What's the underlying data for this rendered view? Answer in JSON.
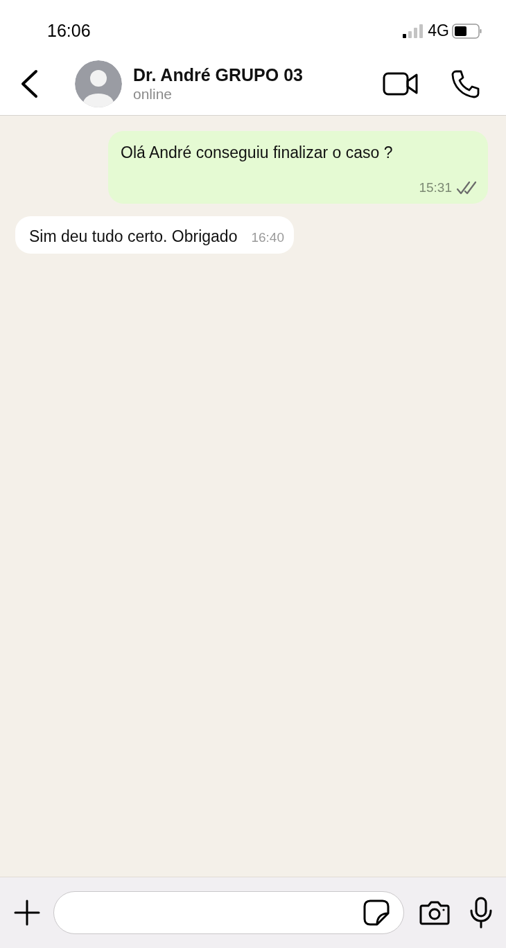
{
  "status_bar": {
    "time": "16:06",
    "network": "4G"
  },
  "header": {
    "name": "Dr. André GRUPO 03",
    "presence": "online"
  },
  "messages": [
    {
      "kind": "sent",
      "text": "Olá André conseguiu finalizar o caso ?",
      "time": "15:31",
      "read": false
    },
    {
      "kind": "received",
      "text": "Sim deu tudo certo. Obrigado",
      "time": "16:40"
    }
  ]
}
